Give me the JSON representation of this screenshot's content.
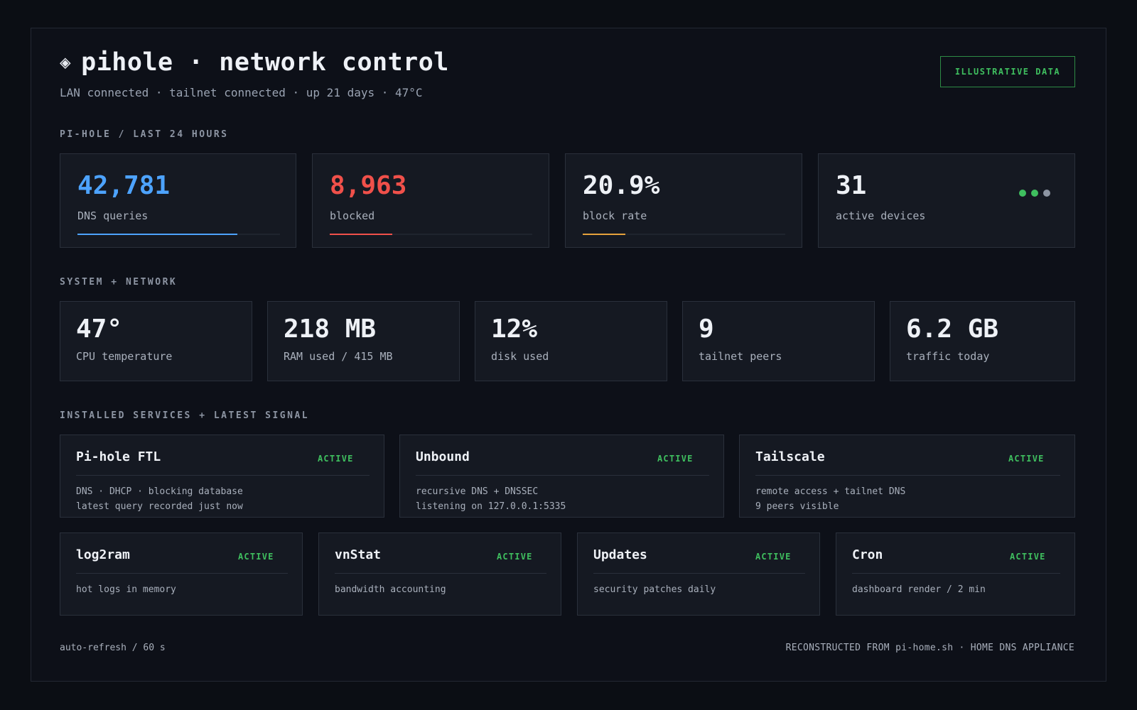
{
  "header": {
    "icon": "diamond-icon",
    "title": "pihole · network control",
    "subtitle": "LAN connected · tailnet connected · up 21 days · 47°C",
    "badge": "ILLUSTRATIVE DATA"
  },
  "sections": {
    "pihole": "PI-HOLE / LAST 24 HOURS",
    "system": "SYSTEM + NETWORK",
    "services": "INSTALLED SERVICES + LATEST SIGNAL"
  },
  "pihole_stats": [
    {
      "value": "42,781",
      "label": "DNS queries",
      "color": "#4da3ff",
      "fill_fraction": 0.79
    },
    {
      "value": "8,963",
      "label": "blocked",
      "color": "#f0504a",
      "fill_fraction": 0.31
    },
    {
      "value": "20.9%",
      "label": "block rate",
      "color": "#e6a23c",
      "fill_fraction": 0.21
    },
    {
      "value": "31",
      "label": "active devices",
      "color": "#eef1f6",
      "dot_colors": [
        "#3fbf5f",
        "#3fbf5f",
        "#8d95a3"
      ]
    }
  ],
  "system_stats": [
    {
      "value": "47°",
      "label": "CPU temperature"
    },
    {
      "value": "218 MB",
      "label": "RAM used / 415 MB"
    },
    {
      "value": "12%",
      "label": "disk used"
    },
    {
      "value": "9",
      "label": "tailnet peers"
    },
    {
      "value": "6.2 GB",
      "label": "traffic today"
    }
  ],
  "services": [
    {
      "name": "Pi-hole FTL",
      "status": "ACTIVE",
      "lines": [
        "DNS · DHCP · blocking database",
        "latest query recorded just now"
      ]
    },
    {
      "name": "Unbound",
      "status": "ACTIVE",
      "lines": [
        "recursive DNS + DNSSEC",
        "listening on 127.0.0.1:5335"
      ]
    },
    {
      "name": "Tailscale",
      "status": "ACTIVE",
      "lines": [
        "remote access + tailnet DNS",
        "9 peers visible"
      ]
    },
    {
      "name": "log2ram",
      "status": "ACTIVE",
      "lines": [
        "hot logs in memory"
      ]
    },
    {
      "name": "vnStat",
      "status": "ACTIVE",
      "lines": [
        "bandwidth accounting"
      ]
    },
    {
      "name": "Updates",
      "status": "ACTIVE",
      "lines": [
        "security patches daily"
      ]
    },
    {
      "name": "Cron",
      "status": "ACTIVE",
      "lines": [
        "dashboard render / 2 min"
      ]
    }
  ],
  "footer": {
    "left": "auto-refresh / 60 s",
    "right": "RECONSTRUCTED FROM pi-home.sh · HOME DNS APPLIANCE"
  },
  "colors": {
    "background": "#0b0e14",
    "card": "#151922",
    "status_active": "#3fbf5f"
  }
}
